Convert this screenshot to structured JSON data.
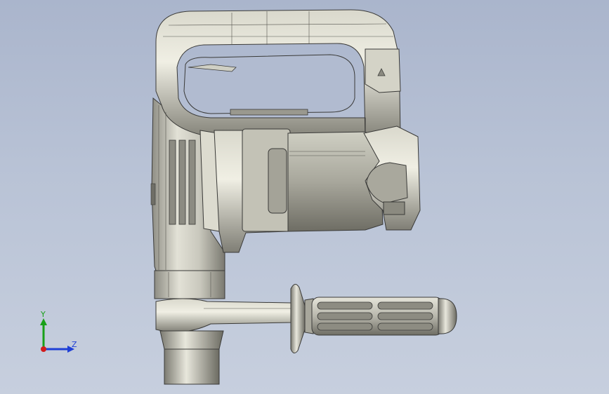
{
  "viewport": {
    "background_top": "#aab5cc",
    "background_bottom": "#c7cfde",
    "model_body_color": "#c9c8bd",
    "model_edge_color": "#3a3a38"
  },
  "triad": {
    "y_label": "Y",
    "z_label": "Z",
    "y_color": "#19a019",
    "z_color": "#1f3fd6",
    "x_color": "#d21c1c",
    "icon": "coordinate-triad-icon"
  }
}
